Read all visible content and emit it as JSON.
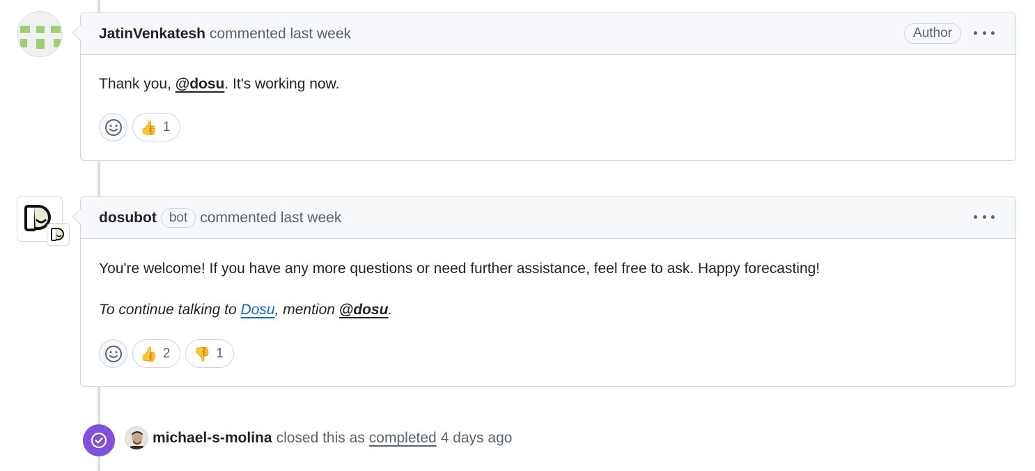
{
  "comments": [
    {
      "author": "JatinVenkatesh",
      "action": "commented last week",
      "badge": "Author",
      "body": {
        "prefix": "Thank you, ",
        "mention": "@dosu",
        "suffix": ". It's working now."
      },
      "reactions": [
        {
          "emoji": "👍",
          "count": "1"
        }
      ]
    },
    {
      "author": "dosubot",
      "bot_label": "bot",
      "action": "commented last week",
      "body": {
        "paragraph1": "You're welcome! If you have any more questions or need further assistance, feel free to ask. Happy forecasting!",
        "p2_prefix": "To continue talking to ",
        "p2_link": "Dosu",
        "p2_middle": ", mention ",
        "p2_mention": "@dosu",
        "p2_suffix": "."
      },
      "reactions": [
        {
          "emoji": "👍",
          "count": "2"
        },
        {
          "emoji": "👎",
          "count": "1"
        }
      ]
    }
  ],
  "event": {
    "user": "michael-s-molina",
    "text": "closed this as",
    "link": "completed",
    "time": "4 days ago"
  },
  "colors": {
    "closed_purple": "#8250df",
    "link_blue": "#0969da",
    "avatar_green": "#9bd170"
  }
}
